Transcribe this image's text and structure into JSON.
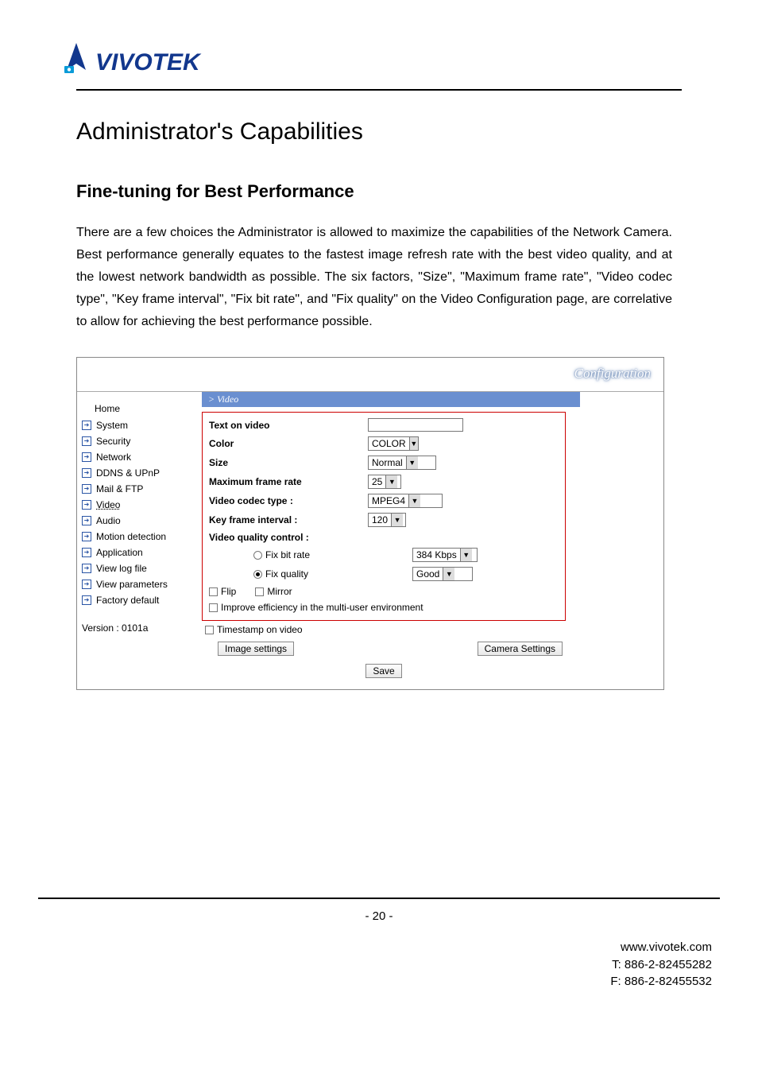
{
  "logo_text": "VIVOTEK",
  "heading": "Administrator's Capabilities",
  "subheading": "Fine-tuning for Best Performance",
  "paragraph": "There are a few choices the Administrator is allowed to maximize the capabilities of the Network Camera. Best performance generally equates to the fastest image refresh rate with the best video quality, and at the lowest network bandwidth as possible. The six factors, \"Size\", \"Maximum frame rate\", \"Video codec type\", \"Key frame interval\", \"Fix bit rate\", and \"Fix quality\" on the Video Configuration page, are correlative to allow for achieving the best performance possible.",
  "panel": {
    "title": "Configuration",
    "crumb": "> Video",
    "sidebar": {
      "home": "Home",
      "items": [
        "System",
        "Security",
        "Network",
        "DDNS & UPnP",
        "Mail & FTP",
        "Video",
        "Audio",
        "Motion detection",
        "Application",
        "View log file",
        "View parameters",
        "Factory default"
      ],
      "version": "Version : 0101a"
    },
    "form": {
      "text_on_video_label": "Text on video",
      "text_on_video_value": "",
      "color_label": "Color",
      "color_value": "COLOR",
      "size_label": "Size",
      "size_value": "Normal",
      "max_frame_label": "Maximum frame rate",
      "max_frame_value": "25",
      "codec_label": "Video codec type :",
      "codec_value": "MPEG4",
      "key_interval_label": "Key frame interval :",
      "key_interval_value": "120",
      "vqc_label": "Video quality control :",
      "fix_bit_label": "Fix bit rate",
      "fix_bit_value": "384 Kbps",
      "fix_quality_label": "Fix quality",
      "fix_quality_value": "Good",
      "flip_label": "Flip",
      "mirror_label": "Mirror",
      "improve_label": "Improve efficiency in the multi-user environment",
      "timestamp_label": "Timestamp on video",
      "image_settings_btn": "Image settings",
      "camera_settings_btn": "Camera  Settings",
      "save_btn": "Save"
    }
  },
  "page_number": "- 20 -",
  "footer": {
    "url": "www.vivotek.com",
    "tel": "T: 886-2-82455282",
    "fax": "F: 886-2-82455532"
  }
}
